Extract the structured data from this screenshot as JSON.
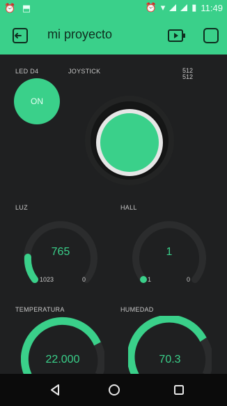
{
  "status_bar": {
    "time": "11:49"
  },
  "app": {
    "title": "mi proyecto"
  },
  "widgets": {
    "led": {
      "label": "LED D4",
      "state": "ON"
    },
    "joystick": {
      "label": "JOYSTICK",
      "x": "512",
      "y": "512"
    },
    "luz": {
      "label": "LUZ",
      "value": "765",
      "min": "1023",
      "max": "0"
    },
    "hall": {
      "label": "HALL",
      "value": "1",
      "min": "1",
      "max": "0"
    },
    "temperatura": {
      "label": "TEMPERATURA",
      "value": "22.000"
    },
    "humedad": {
      "label": "HUMEDAD",
      "value": "70.3"
    }
  },
  "colors": {
    "accent": "#3ad08a",
    "background": "#1f2021",
    "nav": "#0b0b0b"
  },
  "icons": {
    "app_bar": [
      "back-exit-icon",
      "device-play-icon",
      "square-icon"
    ],
    "status_bar": [
      "alarm-icon",
      "dropbox-icon",
      "wifi-icon",
      "signal-icon",
      "battery-icon"
    ],
    "nav": [
      "back-triangle-icon",
      "home-circle-icon",
      "recents-square-icon"
    ]
  }
}
